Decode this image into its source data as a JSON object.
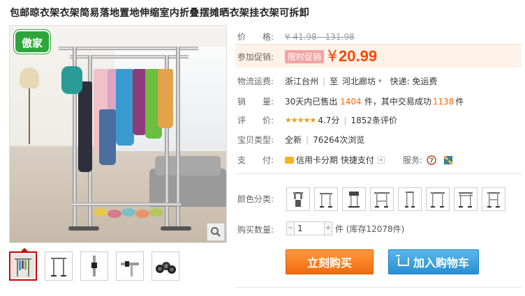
{
  "product": {
    "title": "包邮晾衣架衣架简易落地置地伸缩室内折叠摆摊晒衣架挂衣架可拆卸",
    "logo_text": "傲家"
  },
  "price": {
    "label": "价　　格:",
    "original": "¥ 41.98 - 131.98"
  },
  "promo": {
    "label": "参加促销:",
    "tag": "限时促销",
    "currency": "¥",
    "value": "20.99"
  },
  "shipping": {
    "label": "物流运费:",
    "from": "浙江台州",
    "to_prefix": "至",
    "to": "河北廊坊",
    "delivery": "快递: 免运费"
  },
  "sales": {
    "label": "销　　量:",
    "text_a": "30天内已售出",
    "sold": "1404",
    "text_b": "件，其中交易成功",
    "success": "1138",
    "text_c": "件"
  },
  "rating": {
    "label": "评　　价:",
    "stars": "★★★★★",
    "score": "4.7分",
    "reviews": "1852条评价"
  },
  "item_type": {
    "label": "宝贝类型:",
    "condition": "全新",
    "views": "76264次浏览"
  },
  "payment": {
    "label": "支　　付:",
    "methods": "信用卡分期  快捷支付",
    "service_label": "服务:"
  },
  "variants": {
    "label": "颜色分类:",
    "count": 8
  },
  "quantity": {
    "label": "购买数量:",
    "value": "1",
    "stock": "件 (库存12078件)"
  },
  "actions": {
    "buy": "立刻购买",
    "cart": "加入购物车"
  },
  "colors": {
    "accent": "#ff4400",
    "buy_button": "#f26a10",
    "cart_button": "#2a8fd2"
  }
}
